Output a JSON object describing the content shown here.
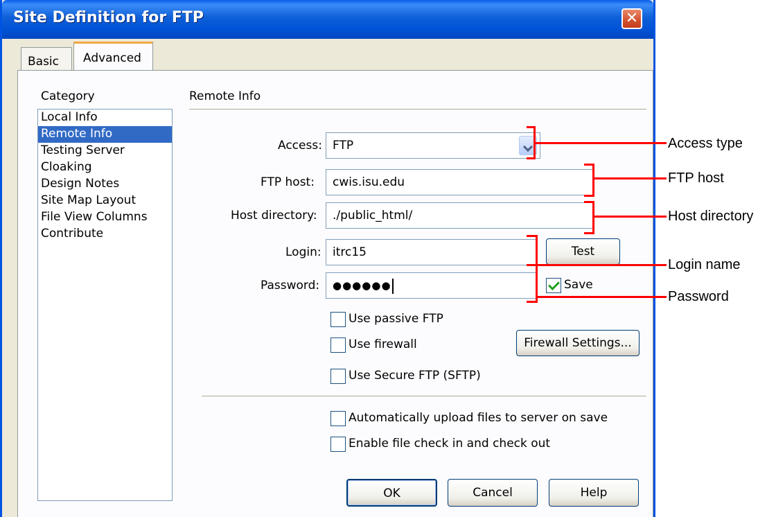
{
  "window": {
    "title": "Site Definition for FTP",
    "close_glyph": "✕"
  },
  "tabs": [
    {
      "label": "Basic"
    },
    {
      "label": "Advanced"
    }
  ],
  "category": {
    "heading": "Category",
    "items": [
      {
        "label": "Local Info"
      },
      {
        "label": "Remote Info"
      },
      {
        "label": "Testing Server"
      },
      {
        "label": "Cloaking"
      },
      {
        "label": "Design Notes"
      },
      {
        "label": "Site Map Layout"
      },
      {
        "label": "File View Columns"
      },
      {
        "label": "Contribute"
      }
    ],
    "selected": "Remote Info"
  },
  "section": {
    "title": "Remote Info"
  },
  "form": {
    "access_label": "Access:",
    "access_value": "FTP",
    "ftp_host_label": "FTP host:",
    "ftp_host_value": "cwis.isu.edu",
    "host_dir_label": "Host directory:",
    "host_dir_value": "./public_html/",
    "login_label": "Login:",
    "login_value": "itrc15",
    "password_label": "Password:",
    "password_value": "●●●●●●",
    "test_label": "Test",
    "save_label": "Save",
    "save_checked": true
  },
  "options": {
    "passive_ftp": {
      "label": "Use passive FTP",
      "checked": false
    },
    "firewall": {
      "label": "Use firewall",
      "checked": false
    },
    "sftp": {
      "label": "Use Secure FTP (SFTP)",
      "checked": false
    },
    "firewall_settings_label": "Firewall Settings...",
    "auto_upload": {
      "label": "Automatically upload files to server on save",
      "checked": false
    },
    "checkin": {
      "label": "Enable file check in and check out",
      "checked": false
    }
  },
  "buttons": {
    "ok": "OK",
    "cancel": "Cancel",
    "help": "Help"
  },
  "annotations": {
    "access_type": "Access type",
    "ftp_host": "FTP host",
    "host_directory": "Host directory",
    "login_name": "Login name",
    "password": "Password"
  },
  "colors": {
    "title_bar": "#0054e3",
    "selection": "#316ac5",
    "annotation": "#ff0000",
    "dialog_bg": "#ece9d8"
  }
}
